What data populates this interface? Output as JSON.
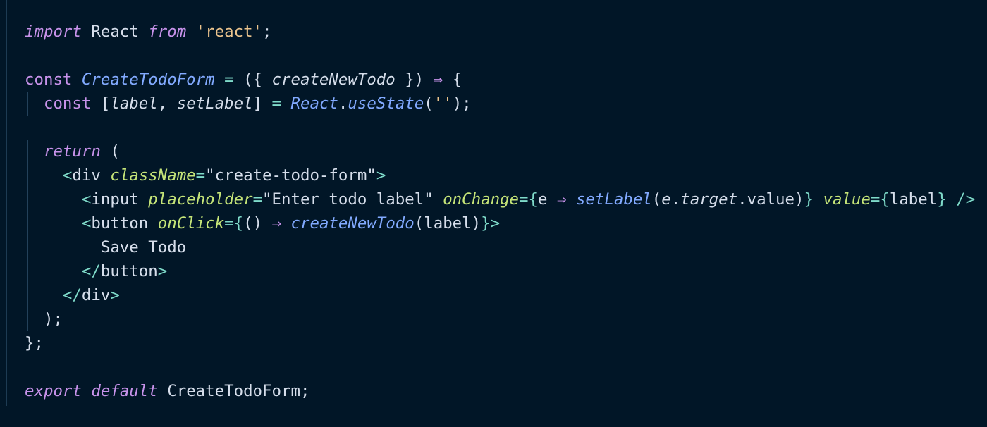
{
  "theme": {
    "background": "#011627",
    "colors": {
      "keyword": "#c792ea",
      "plain": "#d6deeb",
      "string": "#ecc48d",
      "function": "#82aaff",
      "operator": "#7fdbca",
      "attribute": "#c5e478",
      "tag": "#7fdbca",
      "property": "#d6deeb",
      "punct": "#d6deeb"
    }
  },
  "code": {
    "lines": [
      [
        {
          "t": "import",
          "c": "keyword",
          "i": true
        },
        {
          "t": " React ",
          "c": "plain"
        },
        {
          "t": "from",
          "c": "keyword",
          "i": true
        },
        {
          "t": " ",
          "c": "plain"
        },
        {
          "t": "'react'",
          "c": "string"
        },
        {
          "t": ";",
          "c": "punct"
        }
      ],
      [],
      [
        {
          "t": "const ",
          "c": "keyword"
        },
        {
          "t": "CreateTodoForm",
          "c": "function",
          "i": true
        },
        {
          "t": " ",
          "c": "plain"
        },
        {
          "t": "=",
          "c": "operator"
        },
        {
          "t": " ({ ",
          "c": "punct"
        },
        {
          "t": "createNewTodo",
          "c": "plain",
          "i": true
        },
        {
          "t": " }) ",
          "c": "punct"
        },
        {
          "t": "⇒",
          "c": "keyword"
        },
        {
          "t": " {",
          "c": "punct"
        }
      ],
      [
        {
          "t": "  ",
          "c": "plain"
        },
        {
          "t": "const ",
          "c": "keyword"
        },
        {
          "t": "[",
          "c": "punct"
        },
        {
          "t": "label",
          "c": "plain",
          "i": true
        },
        {
          "t": ", ",
          "c": "punct"
        },
        {
          "t": "setLabel",
          "c": "plain",
          "i": true
        },
        {
          "t": "] ",
          "c": "punct"
        },
        {
          "t": "=",
          "c": "operator"
        },
        {
          "t": " ",
          "c": "plain"
        },
        {
          "t": "React",
          "c": "function",
          "i": true
        },
        {
          "t": ".",
          "c": "punct"
        },
        {
          "t": "useState",
          "c": "function",
          "i": true
        },
        {
          "t": "(",
          "c": "punct"
        },
        {
          "t": "''",
          "c": "string"
        },
        {
          "t": ");",
          "c": "punct"
        }
      ],
      [],
      [
        {
          "t": "  ",
          "c": "plain"
        },
        {
          "t": "return",
          "c": "keyword",
          "i": true
        },
        {
          "t": " (",
          "c": "punct"
        }
      ],
      [
        {
          "t": "    ",
          "c": "plain"
        },
        {
          "t": "<",
          "c": "tag"
        },
        {
          "t": "div",
          "c": "plain"
        },
        {
          "t": " ",
          "c": "plain"
        },
        {
          "t": "className",
          "c": "attribute",
          "i": true
        },
        {
          "t": "=",
          "c": "operator"
        },
        {
          "t": "\"create-todo-form\"",
          "c": "plain"
        },
        {
          "t": ">",
          "c": "tag"
        }
      ],
      [
        {
          "t": "      ",
          "c": "plain"
        },
        {
          "t": "<",
          "c": "tag"
        },
        {
          "t": "input",
          "c": "plain"
        },
        {
          "t": " ",
          "c": "plain"
        },
        {
          "t": "placeholder",
          "c": "attribute",
          "i": true
        },
        {
          "t": "=",
          "c": "operator"
        },
        {
          "t": "\"Enter todo label\"",
          "c": "plain"
        },
        {
          "t": " ",
          "c": "plain"
        },
        {
          "t": "onChange",
          "c": "attribute",
          "i": true
        },
        {
          "t": "=",
          "c": "operator"
        },
        {
          "t": "{",
          "c": "operator"
        },
        {
          "t": "e",
          "c": "plain"
        },
        {
          "t": " ",
          "c": "plain"
        },
        {
          "t": "⇒",
          "c": "keyword"
        },
        {
          "t": " ",
          "c": "plain"
        },
        {
          "t": "setLabel",
          "c": "function",
          "i": true
        },
        {
          "t": "(",
          "c": "punct"
        },
        {
          "t": "e",
          "c": "plain",
          "i": true
        },
        {
          "t": ".",
          "c": "punct"
        },
        {
          "t": "target",
          "c": "plain",
          "i": true
        },
        {
          "t": ".",
          "c": "punct"
        },
        {
          "t": "value",
          "c": "plain"
        },
        {
          "t": ")",
          "c": "punct"
        },
        {
          "t": "}",
          "c": "operator"
        },
        {
          "t": " ",
          "c": "plain"
        },
        {
          "t": "value",
          "c": "attribute",
          "i": true
        },
        {
          "t": "=",
          "c": "operator"
        },
        {
          "t": "{",
          "c": "operator"
        },
        {
          "t": "label",
          "c": "plain"
        },
        {
          "t": "}",
          "c": "operator"
        },
        {
          "t": " ",
          "c": "plain"
        },
        {
          "t": "/>",
          "c": "tag"
        }
      ],
      [
        {
          "t": "      ",
          "c": "plain"
        },
        {
          "t": "<",
          "c": "tag"
        },
        {
          "t": "button",
          "c": "plain"
        },
        {
          "t": " ",
          "c": "plain"
        },
        {
          "t": "onClick",
          "c": "attribute",
          "i": true
        },
        {
          "t": "=",
          "c": "operator"
        },
        {
          "t": "{",
          "c": "operator"
        },
        {
          "t": "() ",
          "c": "punct"
        },
        {
          "t": "⇒",
          "c": "keyword"
        },
        {
          "t": " ",
          "c": "plain"
        },
        {
          "t": "createNewTodo",
          "c": "function",
          "i": true
        },
        {
          "t": "(label)",
          "c": "punct"
        },
        {
          "t": "}",
          "c": "operator"
        },
        {
          "t": ">",
          "c": "tag"
        }
      ],
      [
        {
          "t": "        ",
          "c": "plain"
        },
        {
          "t": "Save Todo",
          "c": "plain"
        }
      ],
      [
        {
          "t": "      ",
          "c": "plain"
        },
        {
          "t": "</",
          "c": "tag"
        },
        {
          "t": "button",
          "c": "plain"
        },
        {
          "t": ">",
          "c": "tag"
        }
      ],
      [
        {
          "t": "    ",
          "c": "plain"
        },
        {
          "t": "</",
          "c": "tag"
        },
        {
          "t": "div",
          "c": "plain"
        },
        {
          "t": ">",
          "c": "tag"
        }
      ],
      [
        {
          "t": "  ",
          "c": "plain"
        },
        {
          "t": ");",
          "c": "punct"
        }
      ],
      [
        {
          "t": "};",
          "c": "punct"
        }
      ],
      [],
      [
        {
          "t": "export",
          "c": "keyword",
          "i": true
        },
        {
          "t": " ",
          "c": "plain"
        },
        {
          "t": "default",
          "c": "keyword",
          "i": true
        },
        {
          "t": " CreateTodoForm;",
          "c": "plain"
        }
      ]
    ]
  }
}
